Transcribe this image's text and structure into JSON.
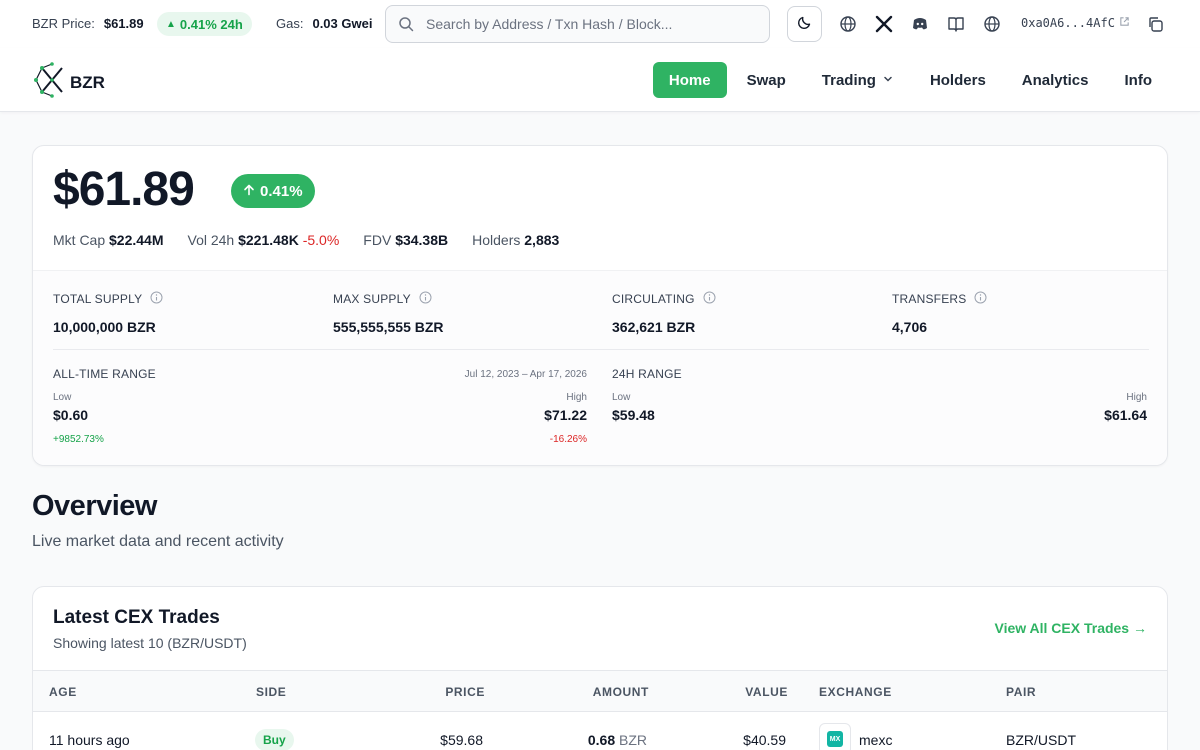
{
  "topbar": {
    "price_label": "BZR Price:",
    "price_value": "$61.89",
    "change_badge": "0.41% 24h",
    "gas_label": "Gas:",
    "gas_value": "0.03 Gwei",
    "search_placeholder": "Search by Address / Txn Hash / Block...",
    "wallet_address": "0xa0A6...4AfC"
  },
  "nav": {
    "logo_text": "BZR",
    "items": [
      {
        "label": "Home"
      },
      {
        "label": "Swap"
      },
      {
        "label": "Trading"
      },
      {
        "label": "Holders"
      },
      {
        "label": "Analytics"
      },
      {
        "label": "Info"
      }
    ]
  },
  "hero": {
    "price": "$61.89",
    "change_pill": "0.41%",
    "stats": {
      "mkt_cap_label": "Mkt Cap",
      "mkt_cap_value": "$22.44M",
      "vol_label": "Vol 24h",
      "vol_value": "$221.48K",
      "vol_change": "-5.0%",
      "fdv_label": "FDV",
      "fdv_value": "$34.38B",
      "holders_label": "Holders",
      "holders_value": "2,883"
    },
    "supply": [
      {
        "label": "TOTAL SUPPLY",
        "value": "10,000,000 BZR"
      },
      {
        "label": "MAX SUPPLY",
        "value": "555,555,555 BZR"
      },
      {
        "label": "CIRCULATING",
        "value": "362,621 BZR"
      },
      {
        "label": "TRANSFERS",
        "value": "4,706"
      }
    ],
    "all_time": {
      "title": "ALL-TIME RANGE",
      "dates": "Jul 12, 2023 – Apr 17, 2026",
      "low_label": "Low",
      "low_value": "$0.60",
      "low_pct": "+9852.73%",
      "high_label": "High",
      "high_value": "$71.22",
      "high_pct": "-16.26%"
    },
    "day_range": {
      "title": "24H RANGE",
      "low_label": "Low",
      "low_value": "$59.48",
      "high_label": "High",
      "high_value": "$61.64"
    }
  },
  "overview": {
    "title": "Overview",
    "subtitle": "Live market data and recent activity"
  },
  "trades": {
    "title": "Latest CEX Trades",
    "subtitle": "Showing latest 10 (BZR/USDT)",
    "link": "View All CEX Trades →",
    "columns": [
      "AGE",
      "SIDE",
      "PRICE",
      "AMOUNT",
      "VALUE",
      "EXCHANGE",
      "PAIR"
    ],
    "rows": [
      {
        "age": "11 hours ago",
        "side": "Buy",
        "price": "$59.68",
        "amount": "0.68",
        "amount_unit": "BZR",
        "value": "$40.59",
        "exchange_logo": "MX",
        "exchange": "mexc",
        "pair": "BZR/USDT"
      }
    ]
  },
  "colors": {
    "accent": "#2fb363",
    "positive": "#16a34a",
    "negative": "#dc2626"
  }
}
